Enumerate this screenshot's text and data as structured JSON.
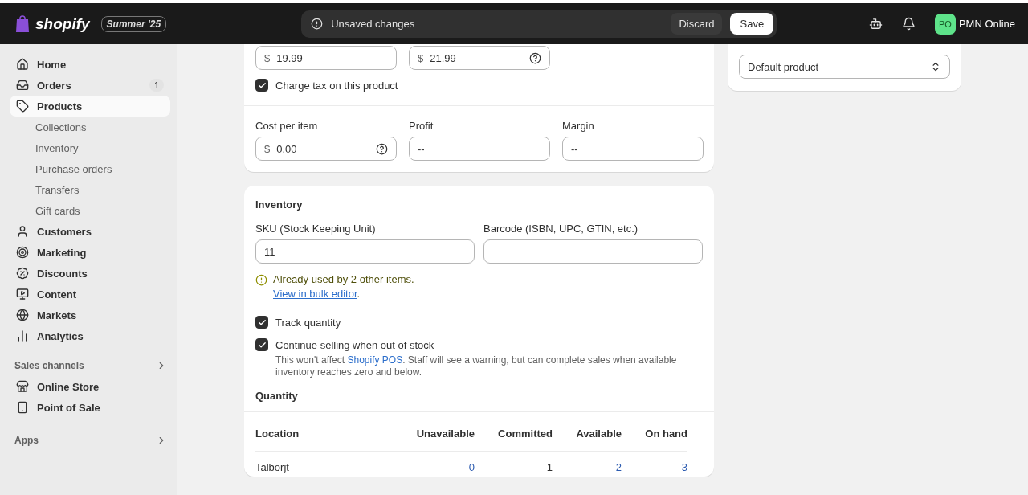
{
  "topbar": {
    "logo": "shopify",
    "edition": "Summer '25",
    "notice": "Unsaved changes",
    "discard": "Discard",
    "save": "Save",
    "account": {
      "initials": "PO",
      "name": "PMN Online"
    }
  },
  "sidebar": {
    "items": [
      {
        "kind": "main",
        "label": "Home",
        "selected": false
      },
      {
        "kind": "main",
        "label": "Orders",
        "selected": false,
        "badge": "1"
      },
      {
        "kind": "main",
        "label": "Products",
        "selected": true
      },
      {
        "kind": "sub",
        "label": "Collections",
        "selected": false
      },
      {
        "kind": "sub",
        "label": "Inventory",
        "selected": false
      },
      {
        "kind": "sub",
        "label": "Purchase orders",
        "selected": false
      },
      {
        "kind": "sub",
        "label": "Transfers",
        "selected": false
      },
      {
        "kind": "sub",
        "label": "Gift cards",
        "selected": false
      },
      {
        "kind": "main",
        "label": "Customers",
        "selected": false
      },
      {
        "kind": "main",
        "label": "Marketing",
        "selected": false
      },
      {
        "kind": "main",
        "label": "Discounts",
        "selected": false
      },
      {
        "kind": "main",
        "label": "Content",
        "selected": false
      },
      {
        "kind": "main",
        "label": "Markets",
        "selected": false
      },
      {
        "kind": "main",
        "label": "Analytics",
        "selected": false
      },
      {
        "kind": "section",
        "label": "Sales channels"
      },
      {
        "kind": "main",
        "label": "Online Store",
        "selected": false
      },
      {
        "kind": "main",
        "label": "Point of Sale",
        "selected": false
      },
      {
        "kind": "section",
        "label": "Apps"
      }
    ]
  },
  "pricing": {
    "prices": [
      {
        "prefix": "$",
        "value": "19.99",
        "help": false
      },
      {
        "prefix": "$",
        "value": "21.99",
        "help": true
      }
    ],
    "charge_tax": {
      "label": "Charge tax on this product",
      "checked": true
    },
    "cost_fields": [
      {
        "label": "Cost per item",
        "prefix": "$",
        "value": "0.00",
        "help": true
      },
      {
        "label": "Profit",
        "value": "--",
        "help": false
      },
      {
        "label": "Margin",
        "value": "--",
        "help": false
      }
    ]
  },
  "inventory": {
    "title": "Inventory",
    "fields": [
      {
        "label": "SKU (Stock Keeping Unit)",
        "value": "11"
      },
      {
        "label": "Barcode (ISBN, UPC, GTIN, etc.)"
      }
    ],
    "warning": {
      "text": "Already used by 2 other items. ",
      "link": "View in bulk editor",
      "end": "."
    },
    "options": [
      {
        "label": "Track quantity",
        "checked": true
      },
      {
        "label": "Continue selling when out of stock",
        "checked": true,
        "help_before": "This won't affect ",
        "help_link": "Shopify POS",
        "help_after": ". Staff will see a warning, but can complete sales when available inventory reaches zero and below."
      }
    ],
    "quantity_title": "Quantity",
    "table": {
      "columns": [
        "Location",
        "Unavailable",
        "Committed",
        "Available",
        "On hand"
      ],
      "rows": [
        {
          "location": "Talborjt",
          "values": [
            {
              "text": "0",
              "link": true
            },
            {
              "text": "1",
              "link": false
            },
            {
              "text": "2",
              "link": true
            },
            {
              "text": "3",
              "link": true
            }
          ]
        }
      ]
    }
  },
  "theme_template": {
    "value": "Default product"
  }
}
